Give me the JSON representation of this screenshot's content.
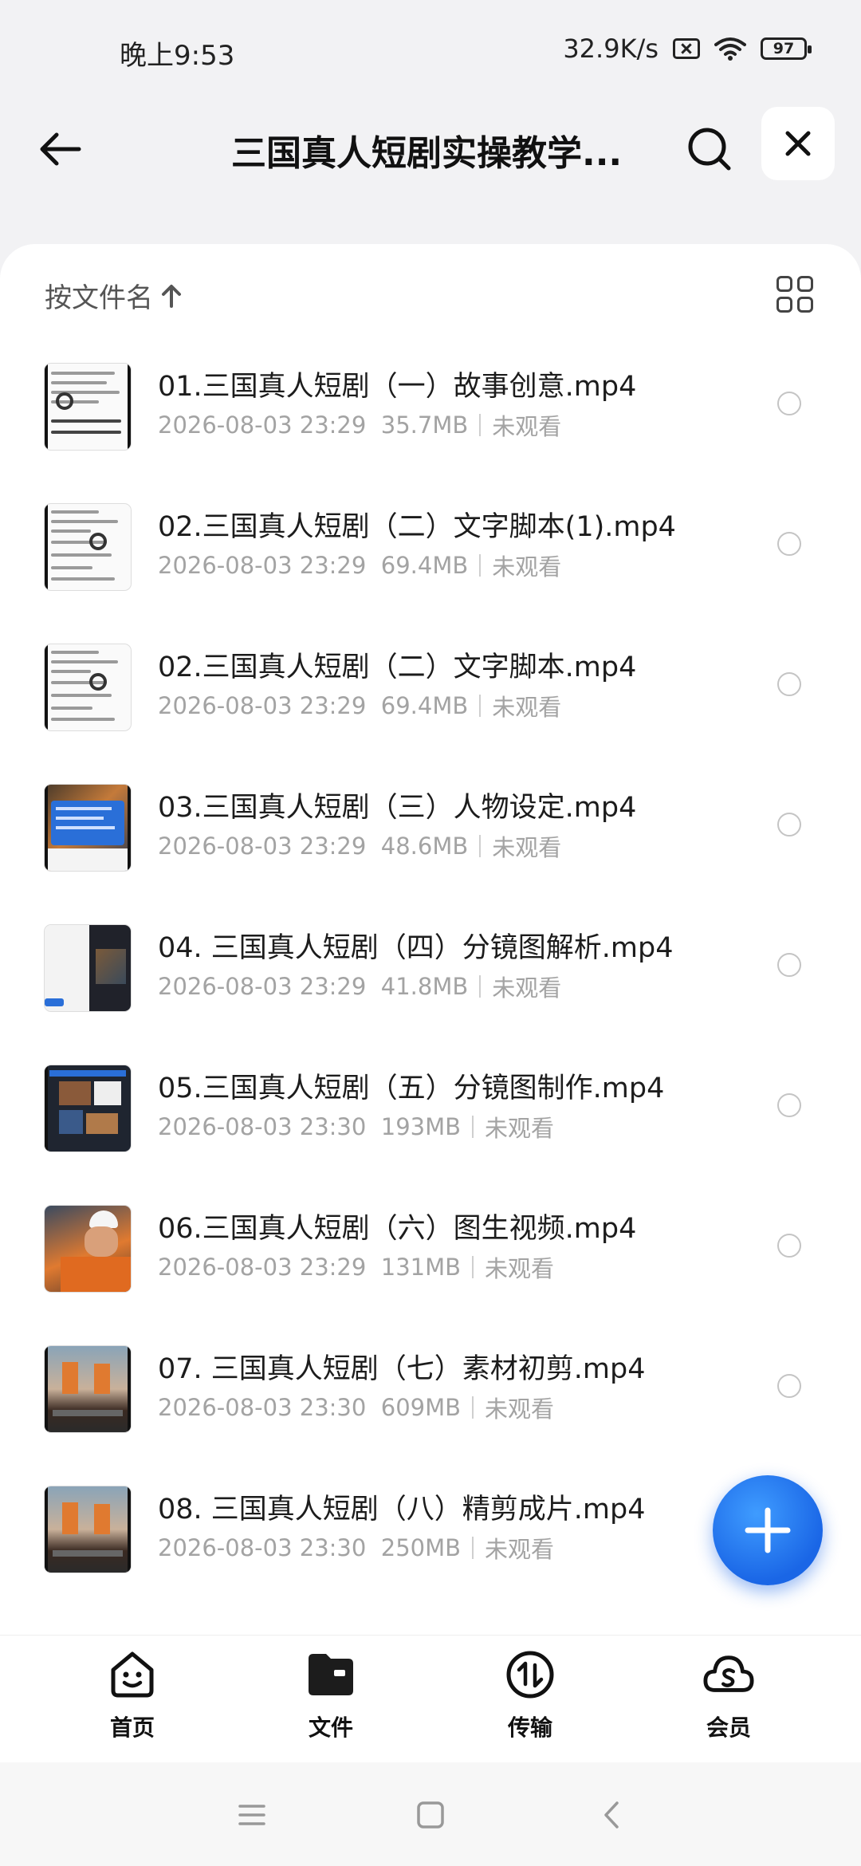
{
  "status_bar": {
    "time": "晚上9:53",
    "network_speed": "32.9K/s",
    "battery": "97",
    "icons": [
      "sim-off-icon",
      "wifi-icon",
      "battery-icon"
    ]
  },
  "header": {
    "title": "三国真人短剧实操教学...",
    "back_icon": "arrow-left-icon",
    "search_icon": "search-icon",
    "close_icon": "close-icon"
  },
  "toolbar": {
    "sort_label": "按文件名",
    "sort_icon": "arrow-up-icon",
    "view_icon": "grid-view-icon"
  },
  "files": [
    {
      "name": "01.三国真人短剧（一）故事创意.mp4",
      "date": "2026-08-03 23:29",
      "size": "35.7MB",
      "status": "未观看"
    },
    {
      "name": "02.三国真人短剧（二）文字脚本(1).mp4",
      "date": "2026-08-03 23:29",
      "size": "69.4MB",
      "status": "未观看"
    },
    {
      "name": "02.三国真人短剧（二）文字脚本.mp4",
      "date": "2026-08-03 23:29",
      "size": "69.4MB",
      "status": "未观看"
    },
    {
      "name": "03.三国真人短剧（三）人物设定.mp4",
      "date": "2026-08-03 23:29",
      "size": "48.6MB",
      "status": "未观看"
    },
    {
      "name": "04. 三国真人短剧（四）分镜图解析.mp4",
      "date": "2026-08-03 23:29",
      "size": "41.8MB",
      "status": "未观看"
    },
    {
      "name": "05.三国真人短剧（五）分镜图制作.mp4",
      "date": "2026-08-03 23:30",
      "size": "193MB",
      "status": "未观看"
    },
    {
      "name": "06.三国真人短剧（六）图生视频.mp4",
      "date": "2026-08-03 23:29",
      "size": "131MB",
      "status": "未观看"
    },
    {
      "name": "07. 三国真人短剧（七）素材初剪.mp4",
      "date": "2026-08-03 23:30",
      "size": "609MB",
      "status": "未观看"
    },
    {
      "name": "08. 三国真人短剧（八）精剪成片.mp4",
      "date": "2026-08-03 23:30",
      "size": "250MB",
      "status": "未观看"
    }
  ],
  "fab": {
    "icon": "plus-icon"
  },
  "bottom_nav": [
    {
      "label": "首页",
      "icon": "smile-home-icon"
    },
    {
      "label": "文件",
      "icon": "folder-icon"
    },
    {
      "label": "传输",
      "icon": "transfer-icon"
    },
    {
      "label": "会员",
      "icon": "cloud-vip-icon"
    }
  ],
  "colors": {
    "accent": "#1a66e6",
    "meta_text": "#a3a3a3",
    "background": "#f2f2f4"
  }
}
